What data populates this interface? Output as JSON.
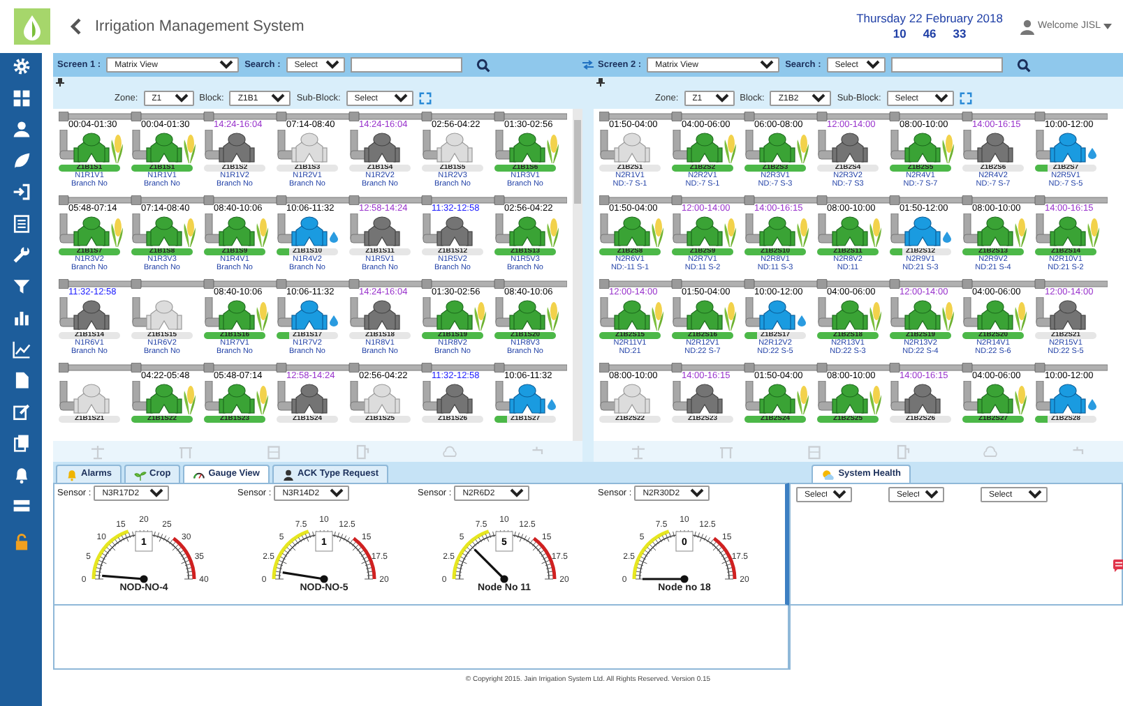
{
  "header": {
    "title": "Irrigation Management System",
    "date": "Thursday 22 February 2018",
    "time": [
      "10",
      "46",
      "33"
    ],
    "user": "Welcome JISL"
  },
  "screens": [
    {
      "label": "Screen 1 :",
      "view": "Matrix View",
      "search_label": "Search :",
      "search": "Select",
      "zone_label": "Zone:",
      "zone": "Z1",
      "block_label": "Block:",
      "block": "Z1B1",
      "sub_block_label": "Sub-Block:",
      "sub_block": "Select",
      "rows": [
        [
          {
            "time": "00:04-01:30",
            "color": "#000000",
            "kind": "active",
            "id": "Z1B1S1",
            "name": "N1R1V1",
            "detail": "Branch No"
          },
          {
            "time": "00:04-01:30",
            "color": "#000000",
            "kind": "active",
            "id": "Z1B1S1",
            "name": "N1R1V1",
            "detail": "Branch No"
          },
          {
            "time": "14:24-16:04",
            "color": "#9933cc",
            "kind": "closed",
            "id": "Z1B1S2",
            "name": "N1R1V2",
            "detail": "Branch No"
          },
          {
            "time": "07:14-08:40",
            "color": "#000000",
            "kind": "off",
            "id": "Z1B1S3",
            "name": "N1R2V1",
            "detail": "Branch No"
          },
          {
            "time": "14:24-16:04",
            "color": "#9933cc",
            "kind": "closed",
            "id": "Z1B1S4",
            "name": "N1R2V2",
            "detail": "Branch No"
          },
          {
            "time": "02:56-04:22",
            "color": "#000000",
            "kind": "off",
            "id": "Z1B1S5",
            "name": "N1R2V3",
            "detail": "Branch No"
          },
          {
            "time": "01:30-02:56",
            "color": "#000000",
            "kind": "active",
            "id": "Z1B1S6",
            "name": "N1R3V1",
            "detail": "Branch No"
          }
        ],
        [
          {
            "time": "05:48-07:14",
            "color": "#000000",
            "kind": "active",
            "id": "Z1B1S7",
            "name": "N1R3V2",
            "detail": "Branch No"
          },
          {
            "time": "07:14-08:40",
            "color": "#000000",
            "kind": "active",
            "id": "Z1B1S8",
            "name": "N1R3V3",
            "detail": "Branch No"
          },
          {
            "time": "08:40-10:06",
            "color": "#000000",
            "kind": "active",
            "id": "Z1B1S9",
            "name": "N1R4V1",
            "detail": "Branch No"
          },
          {
            "time": "10:06-11:32",
            "color": "#000000",
            "kind": "flowing",
            "id": "Z1B1S10",
            "name": "N1R4V2",
            "detail": "Branch No"
          },
          {
            "time": "12:58-14:24",
            "color": "#9933cc",
            "kind": "closed",
            "id": "Z1B1S11",
            "name": "N1R5V1",
            "detail": "Branch No"
          },
          {
            "time": "11:32-12:58",
            "color": "#1a1aff",
            "kind": "closed",
            "id": "Z1B1S12",
            "name": "N1R5V2",
            "detail": "Branch No"
          },
          {
            "time": "02:56-04:22",
            "color": "#000000",
            "kind": "active",
            "id": "Z1B1S13",
            "name": "N1R5V3",
            "detail": "Branch No"
          }
        ],
        [
          {
            "time": "11:32-12:58",
            "color": "#1a1aff",
            "kind": "closed",
            "id": "Z1B1S14",
            "name": "N1R6V1",
            "detail": "Branch No"
          },
          {
            "kind": "off",
            "id": "Z1B1S15",
            "name": "N1R6V2",
            "detail": "Branch No"
          },
          {
            "time": "08:40-10:06",
            "color": "#000000",
            "kind": "active",
            "id": "Z1B1S16",
            "name": "N1R7V1",
            "detail": "Branch No"
          },
          {
            "time": "10:06-11:32",
            "color": "#000000",
            "kind": "flowing",
            "id": "Z1B1S17",
            "name": "N1R7V2",
            "detail": "Branch No"
          },
          {
            "time": "14:24-16:04",
            "color": "#9933cc",
            "kind": "closed",
            "id": "Z1B1S18",
            "name": "N1R8V1",
            "detail": "Branch No"
          },
          {
            "time": "01:30-02:56",
            "color": "#000000",
            "kind": "active",
            "id": "Z1B1S19",
            "name": "N1R8V2",
            "detail": "Branch No"
          },
          {
            "time": "08:40-10:06",
            "color": "#000000",
            "kind": "active",
            "id": "Z1B1S20",
            "name": "N1R8V3",
            "detail": "Branch No"
          }
        ],
        [
          {
            "kind": "off",
            "id": "Z1B1S21"
          },
          {
            "time": "04:22-05:48",
            "color": "#000000",
            "kind": "active",
            "id": "Z1B1S22"
          },
          {
            "time": "05:48-07:14",
            "color": "#000000",
            "kind": "active",
            "id": "Z1B1S23"
          },
          {
            "time": "12:58-14:24",
            "color": "#9933cc",
            "kind": "closed",
            "id": "Z1B1S24"
          },
          {
            "time": "02:56-04:22",
            "color": "#000000",
            "kind": "off",
            "id": "Z1B1S25"
          },
          {
            "time": "11:32-12:58",
            "color": "#1a1aff",
            "kind": "closed",
            "id": "Z1B1S26"
          },
          {
            "time": "10:06-11:32",
            "color": "#000000",
            "kind": "flowing",
            "id": "Z1B1S27"
          }
        ]
      ]
    },
    {
      "label": "Screen 2 :",
      "view": "Matrix View",
      "search_label": "Search :",
      "search": "Select",
      "zone_label": "Zone:",
      "zone": "Z1",
      "block_label": "Block:",
      "block": "Z1B2",
      "sub_block_label": "Sub-Block:",
      "sub_block": "Select",
      "rows": [
        [
          {
            "time": "01:50-04:00",
            "color": "#000000",
            "kind": "off",
            "id": "Z1B2S1",
            "name": "N2R1V1",
            "detail": "ND:-7 S-1"
          },
          {
            "time": "04:00-06:00",
            "color": "#000000",
            "kind": "active",
            "id": "Z1B2S2",
            "name": "N2R2V1",
            "detail": "ND:-7 S-1"
          },
          {
            "time": "06:00-08:00",
            "color": "#000000",
            "kind": "active",
            "id": "Z1B2S3",
            "name": "N2R3V1",
            "detail": "ND:-7 S-3"
          },
          {
            "time": "12:00-14:00",
            "color": "#9933cc",
            "kind": "closed",
            "id": "Z1B2S4",
            "name": "N2R3V2",
            "detail": "ND:-7 S3"
          },
          {
            "time": "08:00-10:00",
            "color": "#000000",
            "kind": "active",
            "id": "Z1B2S5",
            "name": "N2R4V1",
            "detail": "ND:-7 S-7"
          },
          {
            "time": "14:00-16:15",
            "color": "#9933cc",
            "kind": "closed",
            "id": "Z1B2S6",
            "name": "N2R4V2",
            "detail": "ND:-7 S-7"
          },
          {
            "time": "10:00-12:00",
            "color": "#000000",
            "kind": "flowing",
            "id": "Z1B2S7",
            "name": "N2R5V1",
            "detail": "ND:-7 S-5"
          }
        ],
        [
          {
            "time": "01:50-04:00",
            "color": "#000000",
            "kind": "active",
            "id": "Z1B2S8",
            "name": "N2R6V1",
            "detail": "ND:-11 S-1"
          },
          {
            "time": "12:00-14:00",
            "color": "#9933cc",
            "kind": "active",
            "id": "Z1B2S9",
            "name": "N2R7V1",
            "detail": "ND:11 S-2"
          },
          {
            "time": "14:00-16:15",
            "color": "#9933cc",
            "kind": "active",
            "id": "Z1B2S10",
            "name": "N2R8V1",
            "detail": "ND:11 S-3"
          },
          {
            "time": "08:00-10:00",
            "color": "#000000",
            "kind": "active",
            "id": "Z1B2S11",
            "name": "N2R8V2",
            "detail": "ND:11"
          },
          {
            "time": "01:50-12:00",
            "color": "#000000",
            "kind": "flowing",
            "id": "Z1B2S12",
            "name": "N2R9V1",
            "detail": "ND:21 S-3"
          },
          {
            "time": "08:00-10:00",
            "color": "#000000",
            "kind": "active",
            "id": "Z1B2S13",
            "name": "N2R9V2",
            "detail": "ND:21 S-4"
          },
          {
            "time": "14:00-16:15",
            "color": "#9933cc",
            "kind": "active",
            "id": "Z1B2S14",
            "name": "N2R10V1",
            "detail": "ND:21 S-2"
          }
        ],
        [
          {
            "time": "12:00-14:00",
            "color": "#9933cc",
            "kind": "active",
            "id": "Z1B2S15",
            "name": "N2R11V1",
            "detail": "ND:21"
          },
          {
            "time": "01:50-04:00",
            "color": "#000000",
            "kind": "active",
            "id": "Z1B2S16",
            "name": "N2R12V1",
            "detail": "ND:22 S-7"
          },
          {
            "time": "10:00-12:00",
            "color": "#000000",
            "kind": "flowing",
            "id": "Z1B2S17",
            "name": "N2R12V2",
            "detail": "ND:22 S-5"
          },
          {
            "time": "04:00-06:00",
            "color": "#000000",
            "kind": "active",
            "id": "Z1B2S18",
            "name": "N2R13V1",
            "detail": "ND:22 S-3"
          },
          {
            "time": "12:00-14:00",
            "color": "#9933cc",
            "kind": "active",
            "id": "Z1B2S19",
            "name": "N2R13V2",
            "detail": "ND:22 S-4"
          },
          {
            "time": "04:00-06:00",
            "color": "#000000",
            "kind": "active",
            "id": "Z1B2S20",
            "name": "N2R14V1",
            "detail": "ND:22 S-6"
          },
          {
            "time": "12:00-14:00",
            "color": "#9933cc",
            "kind": "closed",
            "id": "Z1B2S21",
            "name": "N2R15V1",
            "detail": "ND:22 S-5"
          }
        ],
        [
          {
            "time": "08:00-10:00",
            "color": "#000000",
            "kind": "off",
            "id": "Z1B2S22"
          },
          {
            "time": "14:00-16:15",
            "color": "#9933cc",
            "kind": "closed",
            "id": "Z1B2S23"
          },
          {
            "time": "01:50-04:00",
            "color": "#000000",
            "kind": "active",
            "id": "Z1B2S24"
          },
          {
            "time": "08:00-10:00",
            "color": "#000000",
            "kind": "active",
            "id": "Z1B2S25"
          },
          {
            "time": "14:00-16:15",
            "color": "#9933cc",
            "kind": "closed",
            "id": "Z1B2S26"
          },
          {
            "time": "04:00-06:00",
            "color": "#000000",
            "kind": "active",
            "id": "Z1B2S27"
          },
          {
            "time": "10:00-12:00",
            "color": "#000000",
            "kind": "flowing",
            "id": "Z1B2S28"
          }
        ]
      ]
    }
  ],
  "tabs": [
    {
      "label": "Alarms",
      "selected": false
    },
    {
      "label": "Crop",
      "selected": false
    },
    {
      "label": "Gauge View",
      "selected": true
    },
    {
      "label": "ACK Type Request",
      "selected": false
    }
  ],
  "side_tab": {
    "label": "System Health",
    "selected": true
  },
  "gauges": [
    {
      "sensor_label": "Sensor :",
      "sensor": "N3R17D2",
      "scale": [
        "0",
        "5",
        "10",
        "15",
        "20",
        "25",
        "30",
        "35",
        "40"
      ],
      "value": "1",
      "name": "NOD-NO-4"
    },
    {
      "sensor_label": "Sensor :",
      "sensor": "N3R14D2",
      "scale": [
        "0",
        "2.5",
        "5",
        "7.5",
        "10",
        "12.5",
        "15",
        "17.5",
        "20"
      ],
      "value": "1",
      "name": "NOD-NO-5"
    },
    {
      "sensor_label": "Sensor :",
      "sensor": "N2R6D2",
      "scale": [
        "0",
        "2.5",
        "5",
        "7.5",
        "10",
        "12.5",
        "15",
        "17.5",
        "20"
      ],
      "value": "5",
      "name": "Node No 11"
    },
    {
      "sensor_label": "Sensor :",
      "sensor": "N2R30D2",
      "scale": [
        "0",
        "2.5",
        "5",
        "7.5",
        "10",
        "12.5",
        "15",
        "17.5",
        "20"
      ],
      "value": "0",
      "name": "Node no 18"
    }
  ],
  "health_filters": [
    "Select",
    "Select",
    "Select"
  ],
  "footer": "© Copyright 2015. Jain Irrigation System Ltd. All Rights Reserved. Version 0.15"
}
